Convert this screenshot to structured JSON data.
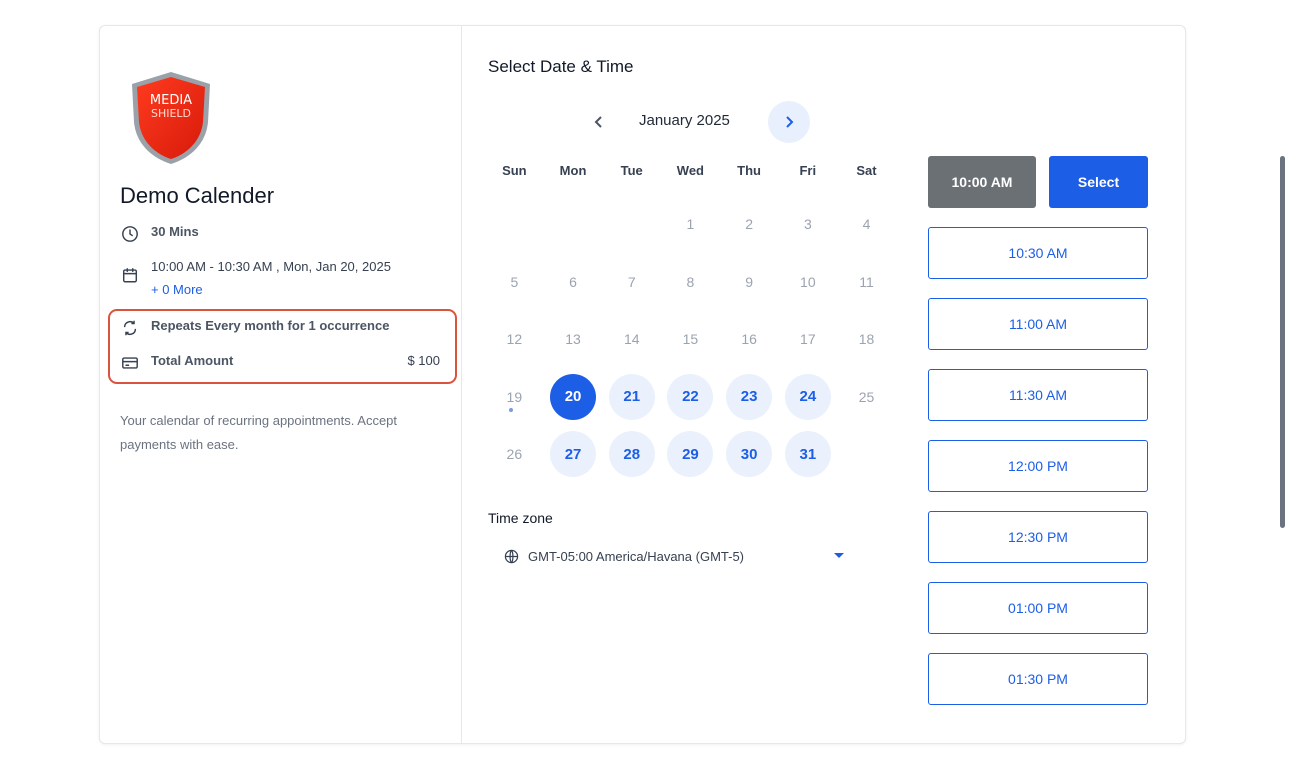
{
  "event": {
    "logo_text_top": "MEDIA",
    "logo_text_bottom": "SHIELD",
    "title": "Demo Calender",
    "duration": "30 Mins",
    "datetime": "10:00 AM - 10:30 AM , Mon, Jan 20, 2025",
    "more_link": "+ 0 More",
    "repeat": "Repeats Every month for 1 occurrence",
    "amount_label": "Total Amount",
    "amount_value": "$ 100",
    "description": "Your calendar of recurring appointments. Accept payments with ease."
  },
  "scheduler": {
    "title": "Select Date & Time",
    "month_label": "January 2025",
    "weekdays": [
      "Sun",
      "Mon",
      "Tue",
      "Wed",
      "Thu",
      "Fri",
      "Sat"
    ],
    "weeks": [
      [
        "",
        "",
        "",
        "1",
        "2",
        "3",
        "4"
      ],
      [
        "5",
        "6",
        "7",
        "8",
        "9",
        "10",
        "11"
      ],
      [
        "12",
        "13",
        "14",
        "15",
        "16",
        "17",
        "18"
      ],
      [
        "19",
        "20",
        "21",
        "22",
        "23",
        "24",
        "25"
      ],
      [
        "26",
        "27",
        "28",
        "29",
        "30",
        "31",
        ""
      ]
    ],
    "selected_day": "20",
    "available_days": [
      "21",
      "22",
      "23",
      "24",
      "27",
      "28",
      "29",
      "30",
      "31"
    ],
    "timezone_label": "Time zone",
    "timezone_value": "GMT-05:00 America/Havana (GMT-5)"
  },
  "slots": {
    "selected_time": "10:00 AM",
    "select_label": "Select",
    "times": [
      "10:30 AM",
      "11:00 AM",
      "11:30 AM",
      "12:00 PM",
      "12:30 PM",
      "01:00 PM",
      "01:30 PM"
    ]
  },
  "colors": {
    "accent": "#1d5ee6",
    "accent_light": "#eaf1fd",
    "highlight_border": "#d9533f",
    "selected_slot_bg": "#6b7075"
  }
}
